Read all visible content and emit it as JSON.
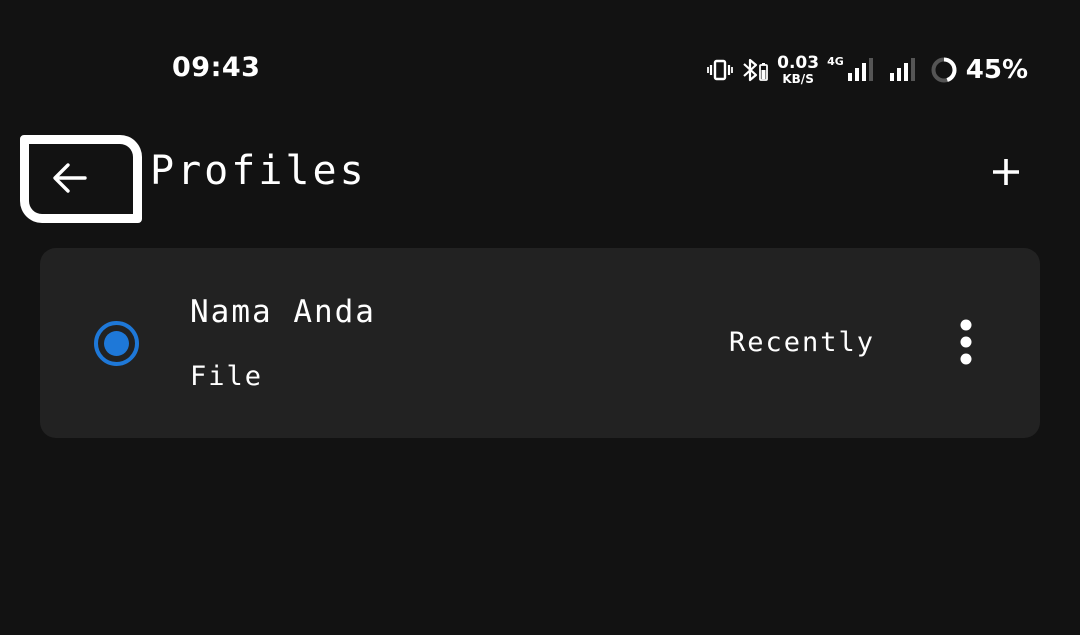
{
  "status_bar": {
    "time": "09:43",
    "net_speed_value": "0.03",
    "net_speed_unit": "KB/S",
    "network_type": "4G",
    "battery_percent": "45%",
    "icons": [
      "vibrate-icon",
      "bluetooth-battery-icon",
      "signal-4g-icon",
      "signal-icon",
      "battery-ring-icon"
    ]
  },
  "app_bar": {
    "title": "Profiles",
    "back_icon": "arrow-left-icon",
    "add_icon": "plus-icon"
  },
  "profiles": [
    {
      "name": "Nama Anda",
      "type": "File",
      "updated": "Recently",
      "selected": true,
      "menu_icon": "more-vertical-icon"
    }
  ],
  "colors": {
    "background": "#121212",
    "card": "#222222",
    "accent": "#1e78d8",
    "text": "#ffffff"
  }
}
